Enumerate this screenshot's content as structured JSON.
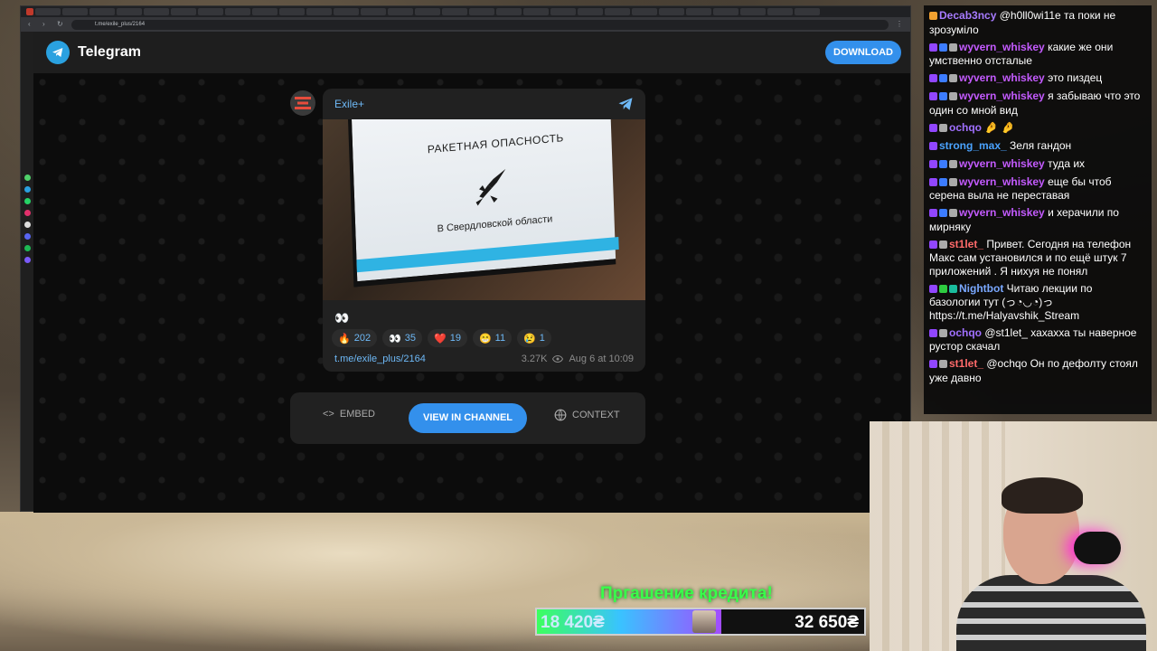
{
  "browser": {
    "url": "t.me/exile_plus/2164"
  },
  "telegram": {
    "title": "Telegram",
    "download_label": "DOWNLOAD",
    "post": {
      "channel": "Exile+",
      "image_headline": "РАКЕТНАЯ ОПАСНОСТЬ",
      "image_region": "В Свердловской области",
      "caption": "👀",
      "reactions": [
        {
          "emoji": "🔥",
          "count": "202"
        },
        {
          "emoji": "👀",
          "count": "35"
        },
        {
          "emoji": "❤️",
          "count": "19"
        },
        {
          "emoji": "😁",
          "count": "11"
        },
        {
          "emoji": "😢",
          "count": "1"
        }
      ],
      "link": "t.me/exile_plus/2164",
      "views": "3.27K",
      "date": "Aug 6 at 10:09"
    },
    "actions": {
      "embed": "EMBED",
      "view_in_channel": "VIEW IN CHANNEL",
      "context": "CONTEXT"
    }
  },
  "chat": {
    "messages": [
      {
        "user": "Decab3ncy",
        "color": "#a77bff",
        "text": "@h0ll0wi11e та поки не зрозуміло"
      },
      {
        "user": "wyvern_whiskey",
        "color": "#c45bff",
        "text": "какие же они умственно отсталые"
      },
      {
        "user": "wyvern_whiskey",
        "color": "#c45bff",
        "text": "это пиздец"
      },
      {
        "user": "wyvern_whiskey",
        "color": "#c45bff",
        "text": "я забываю что это один со мной вид"
      },
      {
        "user": "ochqo",
        "color": "#a070ff",
        "text": "🤌 🤌"
      },
      {
        "user": "strong_max_",
        "color": "#4aa3ff",
        "text": "Зеля гандон"
      },
      {
        "user": "wyvern_whiskey",
        "color": "#c45bff",
        "text": "туда их"
      },
      {
        "user": "wyvern_whiskey",
        "color": "#c45bff",
        "text": "еще бы чтоб серена выла не переставая"
      },
      {
        "user": "wyvern_whiskey",
        "color": "#c45bff",
        "text": "и херачили по мирняку"
      },
      {
        "user": "st1let_",
        "color": "#ff6a6a",
        "text": "Привет. Сегодня на телефон Макс сам установился и по ещё штук 7 приложений . Я нихуя не понял"
      },
      {
        "user": "Nightbot",
        "color": "#7aa8ff",
        "text": "Читаю лекции по базологии тут (っ◔◡◔)っ https://t.me/Halyavshik_Stream"
      },
      {
        "user": "ochqo",
        "color": "#a070ff",
        "text": "@st1let_ хахахха ты наверное рустор скачал"
      },
      {
        "user": "st1let_",
        "color": "#ff6a6a",
        "text": "@ochqo Он по дефолту стоял уже давно"
      }
    ]
  },
  "donation": {
    "title": "Пргашение кредита!",
    "current": "18 420₴",
    "goal": "32 650₴",
    "progress": 0.564
  },
  "colors": {
    "telegram_blue": "#3390ec",
    "link_blue": "#6eb9f7",
    "donation_green": "#38ff4a"
  }
}
